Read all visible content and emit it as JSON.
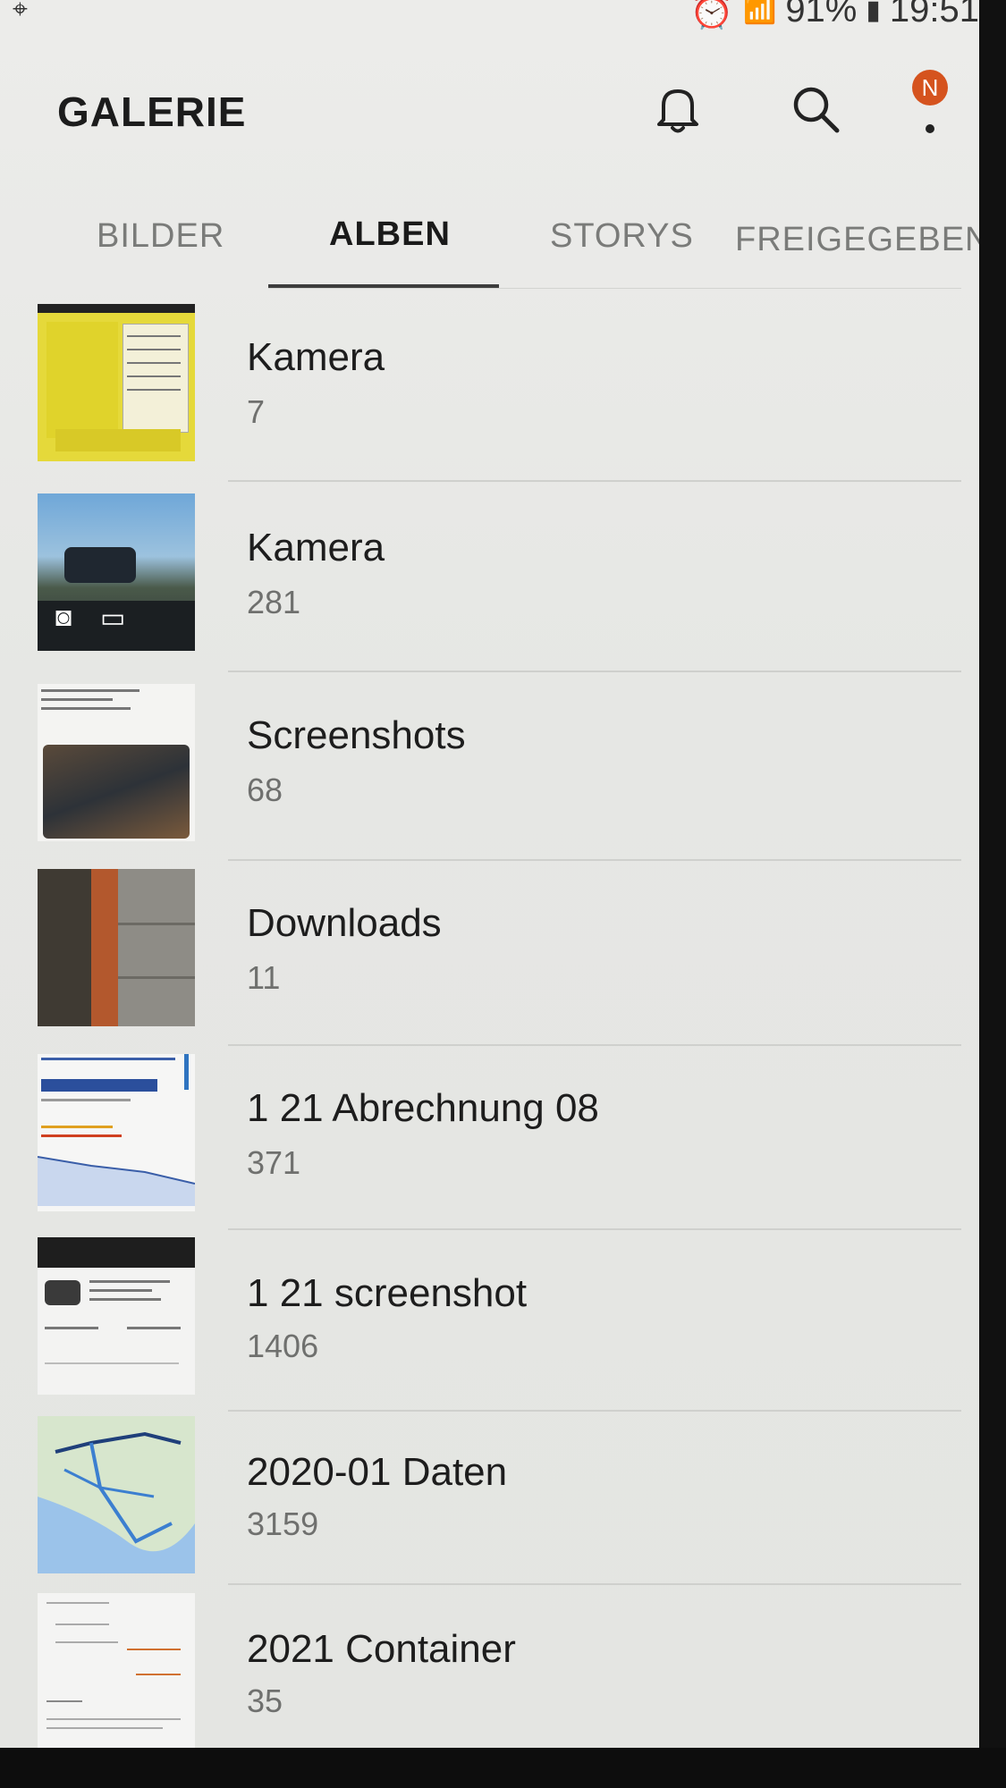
{
  "status_bar": {
    "battery": "91%",
    "time": "19:51"
  },
  "header": {
    "title": "GALERIE",
    "profile_badge": "N",
    "icons": [
      "bell-icon",
      "search-icon",
      "more-vert-icon"
    ]
  },
  "tabs": [
    {
      "label": "BILDER",
      "active": false
    },
    {
      "label": "ALBEN",
      "active": true
    },
    {
      "label": "STORYS",
      "active": false
    },
    {
      "label": "FREIGEGEBEN",
      "active": false
    }
  ],
  "albums": [
    {
      "name": "Kamera",
      "count": "7"
    },
    {
      "name": "Kamera",
      "count": "281"
    },
    {
      "name": "Screenshots",
      "count": "68"
    },
    {
      "name": "Downloads",
      "count": "11"
    },
    {
      "name": "1 21 Abrechnung 08",
      "count": "371"
    },
    {
      "name": "1 21 screenshot",
      "count": "1406"
    },
    {
      "name": "2020-01 Daten",
      "count": "3159"
    },
    {
      "name": "2021 Container",
      "count": "35"
    }
  ],
  "colors": {
    "accent_badge": "#d5531e",
    "background": "#e8e9e6",
    "tab_active": "#1a1a1a",
    "tab_inactive": "#7a7b79"
  }
}
